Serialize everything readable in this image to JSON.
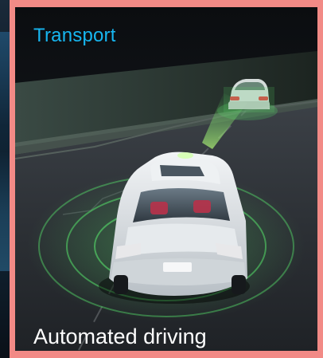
{
  "card": {
    "category": "Transport",
    "caption": "Automated driving"
  },
  "colors": {
    "frame": "#f28a86",
    "category_text": "#17b6f0",
    "caption_text": "#ffffff",
    "sensor_glow": "#56e06a"
  },
  "icons": {
    "hero_image": "autonomous-car-illustration"
  }
}
